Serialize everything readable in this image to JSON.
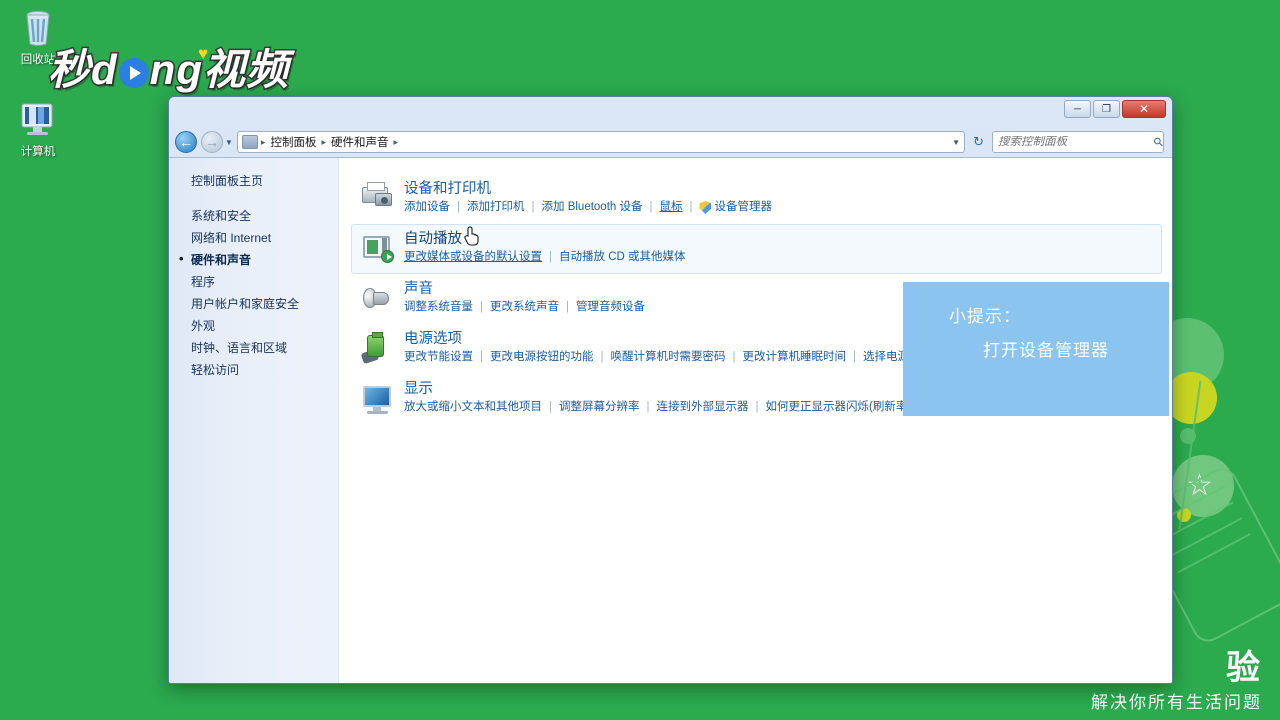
{
  "desktop": {
    "background_color": "#2BAA4E",
    "icons": [
      {
        "name": "recycle-bin",
        "label": "回收站"
      },
      {
        "name": "computer",
        "label": "计算机"
      }
    ],
    "brand": {
      "part1": "秒",
      "part2": "d",
      "part3": "ng",
      "part4": "视频"
    },
    "bottom_brand": "验",
    "bottom_tagline": "解决你所有生活问题"
  },
  "window": {
    "title": "",
    "controls": {
      "minimize": "─",
      "maximize": "❐",
      "close": "✕"
    },
    "nav": {
      "back": "←",
      "forward": "→",
      "dropdown": "▼",
      "refresh": "↻"
    },
    "breadcrumb": {
      "items": [
        "控制面板",
        "硬件和声音"
      ],
      "separator": "▸"
    },
    "search": {
      "placeholder": "搜索控制面板",
      "value": "",
      "icon": "search-icon"
    }
  },
  "sidebar": {
    "home": "控制面板主页",
    "items": [
      {
        "label": "系统和安全",
        "selected": false
      },
      {
        "label": "网络和 Internet",
        "selected": false
      },
      {
        "label": "硬件和声音",
        "selected": true
      },
      {
        "label": "程序",
        "selected": false
      },
      {
        "label": "用户帐户和家庭安全",
        "selected": false
      },
      {
        "label": "外观",
        "selected": false
      },
      {
        "label": "时钟、语言和区域",
        "selected": false
      },
      {
        "label": "轻松访问",
        "selected": false
      }
    ]
  },
  "categories": [
    {
      "icon": "printer-camera-icon",
      "title": "设备和打印机",
      "hover": false,
      "links": [
        {
          "text": "添加设备",
          "underline": false,
          "shield": false
        },
        {
          "text": "添加打印机",
          "underline": false,
          "shield": false
        },
        {
          "text": "添加 Bluetooth 设备",
          "underline": false,
          "shield": false
        },
        {
          "text": "鼠标",
          "underline": true,
          "shield": false
        },
        {
          "text": "设备管理器",
          "underline": false,
          "shield": true
        }
      ]
    },
    {
      "icon": "autoplay-icon",
      "title": "自动播放",
      "hover": true,
      "links": [
        {
          "text": "更改媒体或设备的默认设置",
          "underline": true,
          "shield": false
        },
        {
          "text": "自动播放 CD 或其他媒体",
          "underline": false,
          "shield": false
        }
      ]
    },
    {
      "icon": "speaker-icon",
      "title": "声音",
      "hover": false,
      "links": [
        {
          "text": "调整系统音量",
          "underline": false,
          "shield": false
        },
        {
          "text": "更改系统声音",
          "underline": false,
          "shield": false
        },
        {
          "text": "管理音频设备",
          "underline": false,
          "shield": false
        }
      ]
    },
    {
      "icon": "battery-power-icon",
      "title": "电源选项",
      "hover": false,
      "links": [
        {
          "text": "更改节能设置",
          "underline": false,
          "shield": false
        },
        {
          "text": "更改电源按钮的功能",
          "underline": false,
          "shield": false
        },
        {
          "text": "唤醒计算机时需要密码",
          "underline": false,
          "shield": false
        },
        {
          "text": "更改计算机睡眠时间",
          "underline": false,
          "shield": false
        },
        {
          "text": "选择电源计划",
          "underline": false,
          "shield": false
        }
      ]
    },
    {
      "icon": "monitor-icon",
      "title": "显示",
      "hover": false,
      "links": [
        {
          "text": "放大或缩小文本和其他项目",
          "underline": false,
          "shield": false
        },
        {
          "text": "调整屏幕分辨率",
          "underline": false,
          "shield": false
        },
        {
          "text": "连接到外部显示器",
          "underline": false,
          "shield": false
        },
        {
          "text": "如何更正显示器闪烁(刷新率)",
          "underline": false,
          "shield": false
        }
      ]
    }
  ],
  "tooltip": {
    "background_color": "#8CC4F0",
    "line1": "小提示：",
    "line2": "打开设备管理器"
  }
}
